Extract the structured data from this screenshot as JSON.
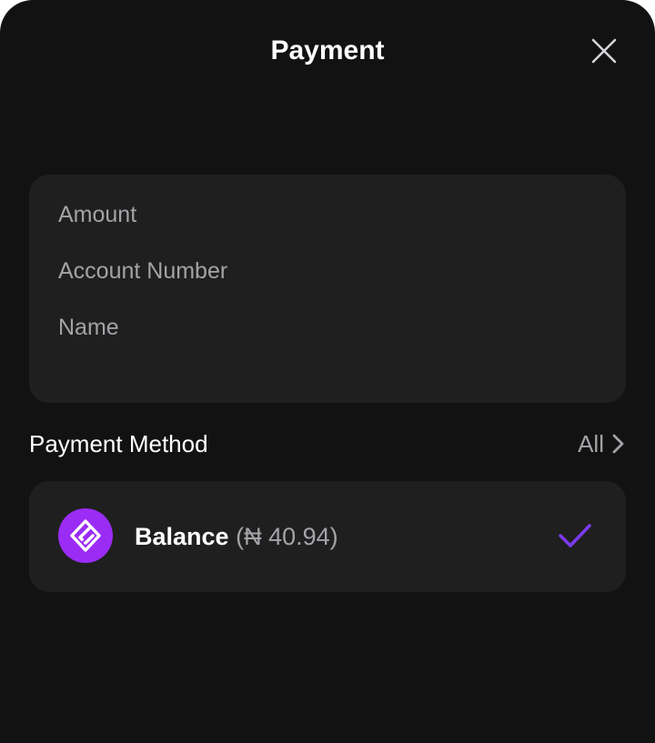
{
  "header": {
    "title": "Payment",
    "close_icon": "close-icon"
  },
  "details": {
    "amount_label": "Amount",
    "account_number_label": "Account Number",
    "name_label": "Name"
  },
  "payment_method": {
    "section_label": "Payment Method",
    "all_label": "All",
    "all_icon": "chevron-right-icon",
    "selected": {
      "name": "Balance",
      "amount_open": "(",
      "currency_symbol": "₦",
      "amount": "40.94",
      "amount_close": ")",
      "logo_icon": "wallet-logo-icon",
      "check_icon": "checkmark-icon"
    }
  },
  "colors": {
    "background": "#121212",
    "card": "#1f1f1f",
    "text_primary": "#ffffff",
    "text_secondary": "#a3a3a8",
    "accent": "#9b2cf5",
    "check": "#7c3aed"
  }
}
